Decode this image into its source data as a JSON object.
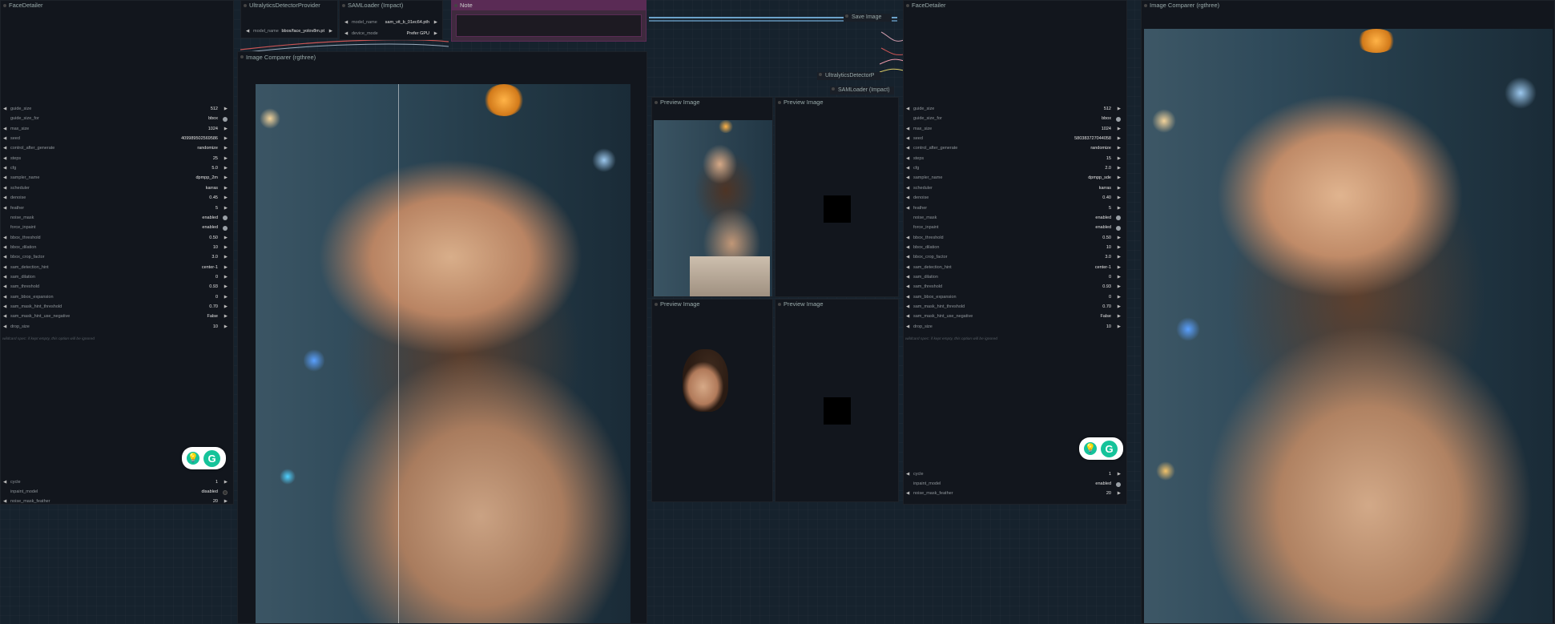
{
  "nodes": {
    "fd_left_title": "FaceDetailer",
    "fd_right_title": "FaceDetailer",
    "ultra_top_title": "UltralyticsDetectorProvider",
    "ultra_top_model_label": "model_name",
    "ultra_top_model_value": "bbox/face_yolov8m.pt",
    "sam_top_title": "SAMLoader (Impact)",
    "sam_top_model_label": "model_name",
    "sam_top_model_value": "sam_vit_b_01ec64.pth",
    "sam_top_device_label": "device_mode",
    "sam_top_device_value": "Prefer GPU",
    "note_title": "Note",
    "cmp_mid_title": "Image Comparer (rgthree)",
    "cmp_right_title": "Image Comparer (rgthree)",
    "preview1_title": "Preview Image",
    "preview2_title": "Preview Image",
    "preview3_title": "Preview Image",
    "preview4_title": "Preview Image",
    "save_title": "Save Image",
    "ultra_mid_title": "UltralyticsDetectorP",
    "sam_mid_title": "SAMLoader (Impact)"
  },
  "fd_left": {
    "rows": [
      {
        "name": "guide_size",
        "value": "512",
        "toggle": false
      },
      {
        "name": "guide_size_for",
        "value": "bbox",
        "toggle": true
      },
      {
        "name": "max_size",
        "value": "1024",
        "toggle": false
      },
      {
        "name": "seed",
        "value": "409989502569586",
        "toggle": false
      },
      {
        "name": "control_after_generate",
        "value": "randomize",
        "toggle": false
      },
      {
        "name": "steps",
        "value": "25",
        "toggle": false
      },
      {
        "name": "cfg",
        "value": "5.0",
        "toggle": false
      },
      {
        "name": "sampler_name",
        "value": "dpmpp_2m",
        "toggle": false
      },
      {
        "name": "scheduler",
        "value": "karras",
        "toggle": false
      },
      {
        "name": "denoise",
        "value": "0.45",
        "toggle": false
      },
      {
        "name": "feather",
        "value": "5",
        "toggle": false
      },
      {
        "name": "noise_mask",
        "value": "enabled",
        "toggle": true
      },
      {
        "name": "force_inpaint",
        "value": "enabled",
        "toggle": true
      },
      {
        "name": "bbox_threshold",
        "value": "0.50",
        "toggle": false
      },
      {
        "name": "bbox_dilation",
        "value": "10",
        "toggle": false
      },
      {
        "name": "bbox_crop_factor",
        "value": "3.0",
        "toggle": false
      },
      {
        "name": "sam_detection_hint",
        "value": "center-1",
        "toggle": false
      },
      {
        "name": "sam_dilation",
        "value": "0",
        "toggle": false
      },
      {
        "name": "sam_threshold",
        "value": "0.93",
        "toggle": false
      },
      {
        "name": "sam_bbox_expansion",
        "value": "0",
        "toggle": false
      },
      {
        "name": "sam_mask_hint_threshold",
        "value": "0.70",
        "toggle": false
      },
      {
        "name": "sam_mask_hint_use_negative",
        "value": "False",
        "toggle": false
      },
      {
        "name": "drop_size",
        "value": "10",
        "toggle": false
      }
    ],
    "hint": "wildcard spec: if kept empty, this option will be ignored",
    "bottom_rows": [
      {
        "name": "cycle",
        "value": "1",
        "toggle": false
      },
      {
        "name": "inpaint_model",
        "value": "disabled",
        "toggle": true,
        "off": true
      },
      {
        "name": "noise_mask_feather",
        "value": "20",
        "toggle": false
      }
    ]
  },
  "fd_right": {
    "rows": [
      {
        "name": "guide_size",
        "value": "512",
        "toggle": false
      },
      {
        "name": "guide_size_for",
        "value": "bbox",
        "toggle": true
      },
      {
        "name": "max_size",
        "value": "1024",
        "toggle": false
      },
      {
        "name": "seed",
        "value": "580383727044058",
        "toggle": false
      },
      {
        "name": "control_after_generate",
        "value": "randomize",
        "toggle": false
      },
      {
        "name": "steps",
        "value": "15",
        "toggle": false
      },
      {
        "name": "cfg",
        "value": "2.0",
        "toggle": false
      },
      {
        "name": "sampler_name",
        "value": "dpmpp_sde",
        "toggle": false
      },
      {
        "name": "scheduler",
        "value": "karras",
        "toggle": false
      },
      {
        "name": "denoise",
        "value": "0.40",
        "toggle": false
      },
      {
        "name": "feather",
        "value": "5",
        "toggle": false
      },
      {
        "name": "noise_mask",
        "value": "enabled",
        "toggle": true
      },
      {
        "name": "force_inpaint",
        "value": "enabled",
        "toggle": true
      },
      {
        "name": "bbox_threshold",
        "value": "0.50",
        "toggle": false
      },
      {
        "name": "bbox_dilation",
        "value": "10",
        "toggle": false
      },
      {
        "name": "bbox_crop_factor",
        "value": "3.0",
        "toggle": false
      },
      {
        "name": "sam_detection_hint",
        "value": "center-1",
        "toggle": false
      },
      {
        "name": "sam_dilation",
        "value": "0",
        "toggle": false
      },
      {
        "name": "sam_threshold",
        "value": "0.93",
        "toggle": false
      },
      {
        "name": "sam_bbox_expansion",
        "value": "0",
        "toggle": false
      },
      {
        "name": "sam_mask_hint_threshold",
        "value": "0.70",
        "toggle": false
      },
      {
        "name": "sam_mask_hint_use_negative",
        "value": "False",
        "toggle": false
      },
      {
        "name": "drop_size",
        "value": "10",
        "toggle": false
      }
    ],
    "hint": "wildcard spec: if kept empty, this option will be ignored",
    "bottom_rows": [
      {
        "name": "cycle",
        "value": "1",
        "toggle": false
      },
      {
        "name": "inpaint_model",
        "value": "enabled",
        "toggle": true
      },
      {
        "name": "noise_mask_feather",
        "value": "20",
        "toggle": false
      }
    ]
  },
  "badge": {
    "bulb": "💡",
    "g": "G"
  },
  "arrows": {
    "left": "◀",
    "right": "▶"
  },
  "colors": {
    "canvas": "#16222d",
    "node_bg": "#12161d",
    "note_purple": "#5a2b55",
    "grammarly": "#15c39a"
  }
}
